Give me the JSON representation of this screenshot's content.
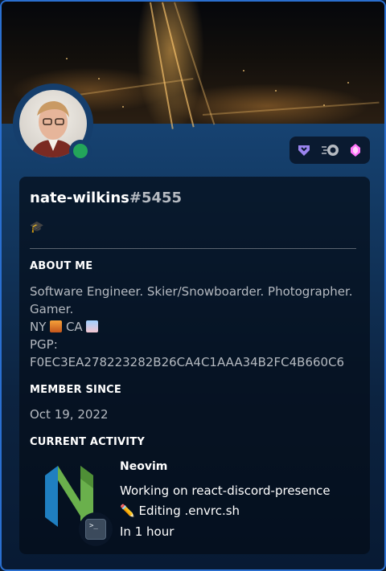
{
  "profile": {
    "username": "nate-wilkins",
    "discriminator": "#5455",
    "custom_status_emoji": "🎓",
    "status_color": "#23a55a"
  },
  "badges": [
    {
      "icon": "hypesquad-badge-icon",
      "color": "#9b84ee"
    },
    {
      "icon": "nitro-badge-icon",
      "color": "#b5bac1"
    },
    {
      "icon": "boost-gem-icon",
      "color": "#ff73fa"
    }
  ],
  "about": {
    "title": "ABOUT ME",
    "line1": "Software Engineer. Skier/Snowboarder. Photographer.",
    "line2": "Gamer.",
    "ny_label": "NY",
    "ca_label": "CA",
    "pgp_label": "PGP:",
    "pgp_key": "F0EC3EA278223282B26CA4C1AAA34B2FC4B660C6"
  },
  "member_since": {
    "title": "MEMBER SINCE",
    "date": "Oct 19, 2022"
  },
  "activity": {
    "title": "CURRENT ACTIVITY",
    "app_name": "Neovim",
    "details": "Working on react-discord-presence",
    "state_emoji": "✏️",
    "state": "Editing .envrc.sh",
    "time": "In 1 hour",
    "small_icon": "terminal-icon",
    "large_icon": "neovim-logo-icon"
  },
  "colors": {
    "accent_border": "#2a6fd0",
    "neovim_green": "#6ab04c",
    "neovim_blue": "#1f7fc1"
  }
}
